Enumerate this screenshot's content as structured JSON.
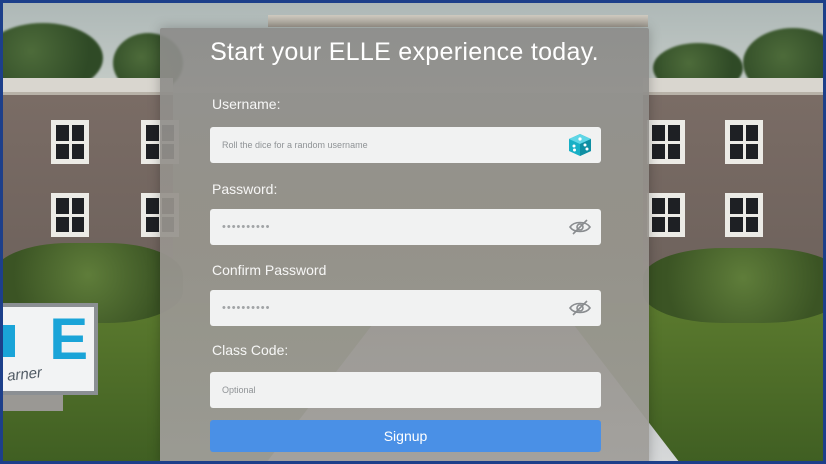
{
  "signup": {
    "title": "Start your ELLE experience today.",
    "username": {
      "label": "Username:",
      "placeholder": "Roll the dice for a random username",
      "dice_icon": "dice-icon"
    },
    "password": {
      "label": "Password:",
      "value": "••••••••••",
      "toggle_icon": "eye-slash-icon"
    },
    "confirm_password": {
      "label": "Confirm Password",
      "value": "••••••••••",
      "toggle_icon": "eye-slash-icon"
    },
    "class_code": {
      "label": "Class Code:",
      "placeholder": "Optional"
    },
    "submit_label": "Signup"
  },
  "background": {
    "sign_text": "arner"
  },
  "colors": {
    "accent": "#4a90e6",
    "dice": "#1bb3c9",
    "frame_border": "#1d3f8a"
  }
}
